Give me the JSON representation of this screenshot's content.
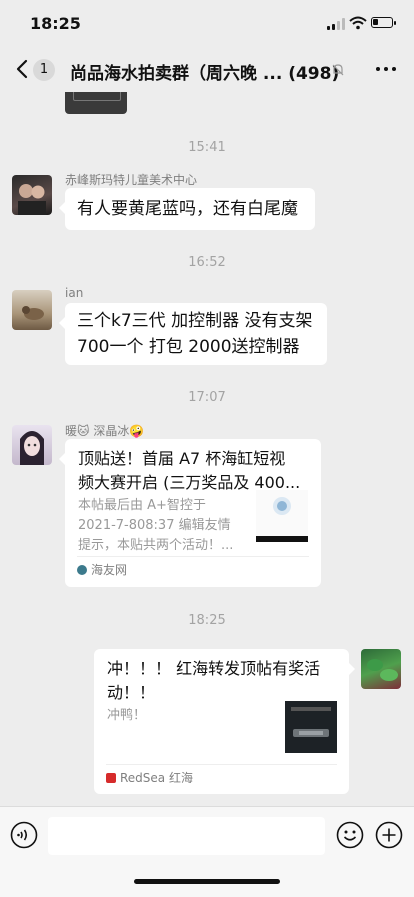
{
  "status": {
    "time": "18:25"
  },
  "nav": {
    "unread": "1",
    "title": "尚品海水拍卖群（周六晚 ... (498)"
  },
  "timestamps": [
    "15:41",
    "16:52",
    "17:07",
    "18:25"
  ],
  "messages": [
    {
      "sender": "赤峰斯玛特儿童美术中心",
      "text": "有人要黄尾蓝吗，还有白尾魔"
    },
    {
      "sender": "ian",
      "line1": "三个k7三代 加控制器 没有支架",
      "line2": "700一个 打包 2000送控制器"
    },
    {
      "sender": "暖🐱 深晶冰🤪",
      "card_title_1": "顶贴送！首届 A7 杯海缸短视",
      "card_title_2": "频大赛开启 (三万奖品及 400...",
      "card_desc_1": "本帖最后由 A+智控于",
      "card_desc_2": "2021-7-808:37 编辑友情",
      "card_desc_3": "提示，本贴共两个活动！...",
      "source": "海友网"
    },
    {
      "card_title_1": "冲！！！ 红海转发顶帖有奖活",
      "card_title_2": "动！！",
      "card_desc": "冲鸭！",
      "source": "RedSea 红海"
    }
  ],
  "colors": {
    "background": "#ededed",
    "bubble": "#ffffff",
    "timestamp": "#a3a3a3"
  }
}
